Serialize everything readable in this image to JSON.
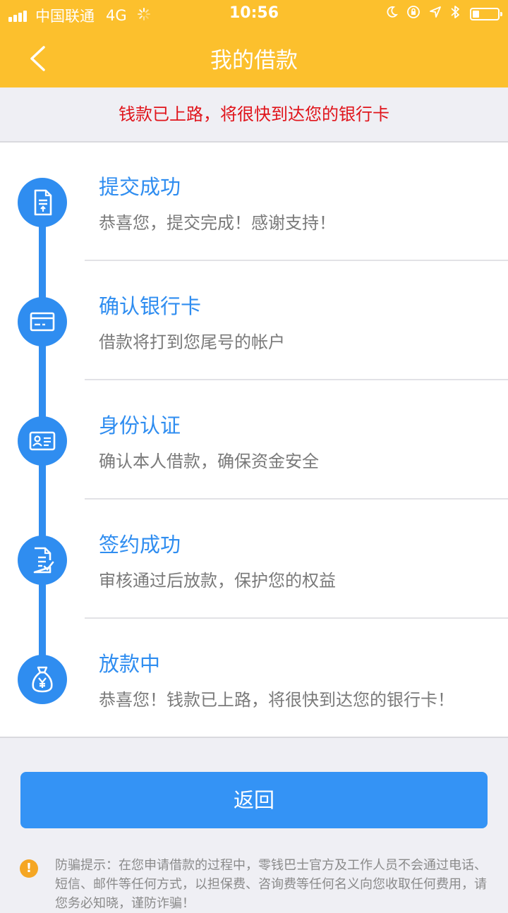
{
  "status_bar": {
    "carrier": "中国联通",
    "network": "4G",
    "time": "10:56",
    "battery_level": 0.25
  },
  "nav": {
    "title": "我的借款"
  },
  "notice": "钱款已上路，将很快到达您的银行卡",
  "steps": [
    {
      "title": "提交成功",
      "desc": "恭喜您，提交完成！感谢支持！",
      "icon": "document-upload-icon"
    },
    {
      "title": "确认银行卡",
      "desc": "借款将打到您尾号的帐户",
      "icon": "bank-card-icon"
    },
    {
      "title": "身份认证",
      "desc": "确认本人借款，确保资金安全",
      "icon": "id-card-icon"
    },
    {
      "title": "签约成功",
      "desc": "审核通过后放款，保护您的权益",
      "icon": "contract-sign-icon"
    },
    {
      "title": "放款中",
      "desc": "恭喜您！钱款已上路，将很快到达您的银行卡！",
      "icon": "money-bag-icon"
    }
  ],
  "return_button": "返回",
  "warning": {
    "icon_glyph": "!",
    "text": "防骗提示：在您申请借款的过程中，零钱巴士官方及工作人员不会通过电话、短信、邮件等任何方式，以担保费、咨询费等任何名义向您收取任何费用，请您务必知晓，谨防诈骗！"
  },
  "colors": {
    "header": "#fcc02d",
    "accent_blue": "#2f8df0",
    "notice_red": "#e0141b",
    "warning_orange": "#f5a623"
  }
}
